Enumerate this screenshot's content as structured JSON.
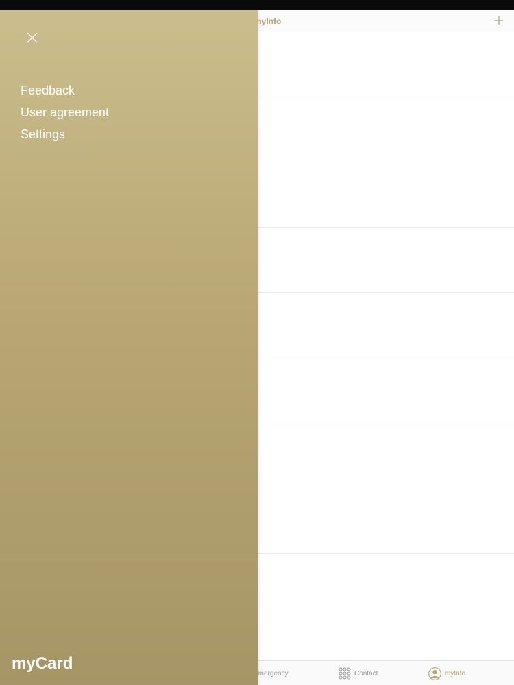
{
  "header": {
    "title": "myInfo"
  },
  "drawer": {
    "menu_items": [
      {
        "label": "Feedback"
      },
      {
        "label": "User agreement"
      },
      {
        "label": "Settings"
      }
    ],
    "brand": "myCard"
  },
  "tabs": [
    {
      "label": "Emergency",
      "icon": "emergency-icon"
    },
    {
      "label": "Contact",
      "icon": "grid-dots-icon"
    },
    {
      "label": "myInfo",
      "icon": "person-icon",
      "active": true
    }
  ],
  "colors": {
    "accent": "#b8a56c",
    "drawer_top": "#cbbd8d",
    "drawer_bottom": "#a69566",
    "tab_inactive": "#9a9a9a"
  }
}
